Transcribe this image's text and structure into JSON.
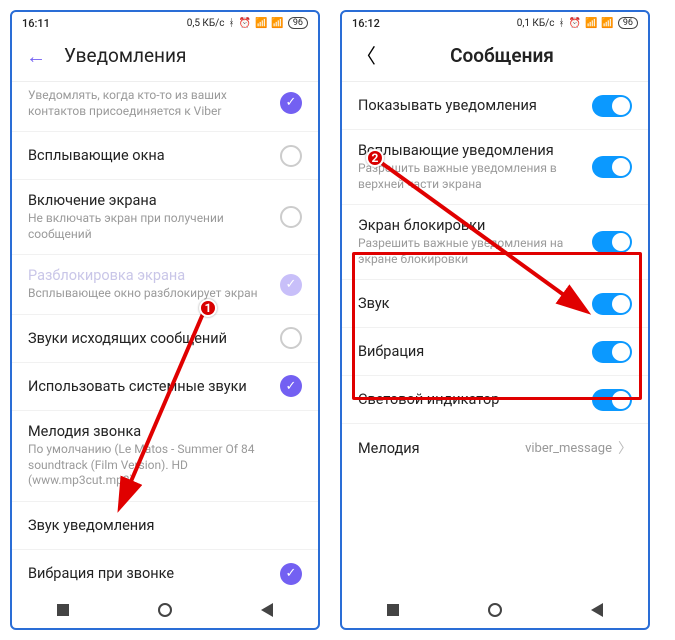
{
  "left": {
    "status": {
      "time": "16:11",
      "net": "0,5 КБ/с",
      "battery": "96"
    },
    "header": {
      "title": "Уведомления"
    },
    "rows": [
      {
        "title": "",
        "sub": "Уведомлять, когда кто-то из ваших контактов присоединяется к Viber",
        "check": "on",
        "truncated": true
      },
      {
        "title": "Всплывающие окна",
        "check": "off"
      },
      {
        "title": "Включение экрана",
        "sub": "Не включать экран при получении сообщений",
        "check": "off"
      },
      {
        "title": "Разблокировка экрана",
        "sub": "Всплывающее окно разблокирует экран",
        "check": "faded",
        "disabled": true
      },
      {
        "title": "Звуки исходящих сообщений",
        "check": "off"
      },
      {
        "title": "Использовать системные звуки",
        "check": "on"
      },
      {
        "title": "Мелодия звонка",
        "sub": "По умолчанию (Le Matos - Summer Of 84 soundtrack (Film Version). HD (www.mp3cut.mp3)",
        "nav": true
      },
      {
        "title": "Звук уведомления",
        "nav": true
      },
      {
        "title": "Вибрация при звонке",
        "check": "on"
      }
    ],
    "marker": "1"
  },
  "right": {
    "status": {
      "time": "16:12",
      "net": "0,1 КБ/с",
      "battery": "96"
    },
    "header": {
      "title": "Сообщения"
    },
    "rows": [
      {
        "title": "Показывать уведомления",
        "toggle": "on"
      },
      {
        "title": "Всплывающие уведомления",
        "sub": "Разрешить важные уведомления в верхней части экрана",
        "toggle": "on"
      },
      {
        "title": "Экран блокировки",
        "sub": "Разрешить важные уведомления на экране блокировки",
        "toggle": "on"
      },
      {
        "title": "Звук",
        "toggle": "on"
      },
      {
        "title": "Вибрация",
        "toggle": "on"
      },
      {
        "title": "Световой индикатор",
        "toggle": "on"
      },
      {
        "title": "Мелодия",
        "value": "viber_message",
        "nav": true
      }
    ],
    "marker": "2"
  }
}
